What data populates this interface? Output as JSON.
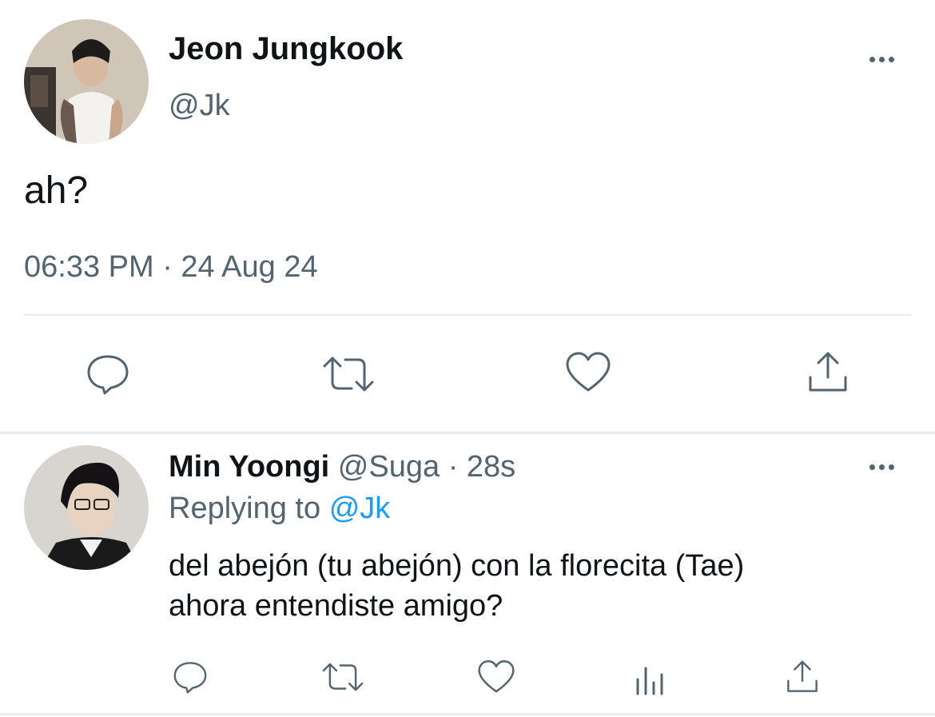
{
  "tweet": {
    "author_name": "Jeon Jungkook",
    "handle": "@Jk",
    "text": "ah?",
    "timestamp": "06:33 PM · 24 Aug 24",
    "avatar_icon": "profile-photo-jungkook",
    "more_icon": "more-options-icon",
    "actions": [
      "reply-icon",
      "retweet-icon",
      "like-icon",
      "share-icon"
    ]
  },
  "reply": {
    "author_name": "Min Yoongi",
    "handle": "@Suga",
    "separator": "·",
    "time": "28s",
    "replying_prefix": "Replying to",
    "replying_handle": "@Jk",
    "text_line1": "del abejón (tu abejón) con la florecita (Tae)",
    "text_line2": "ahora entendiste amigo?",
    "avatar_icon": "profile-photo-yoongi",
    "more_icon": "more-options-icon",
    "actions": [
      "reply-icon",
      "retweet-icon",
      "like-icon",
      "analytics-icon",
      "share-icon"
    ]
  },
  "colors": {
    "text": "#0f1419",
    "muted": "#536471",
    "link": "#1d9bf0",
    "divider": "#e6ecf0"
  }
}
